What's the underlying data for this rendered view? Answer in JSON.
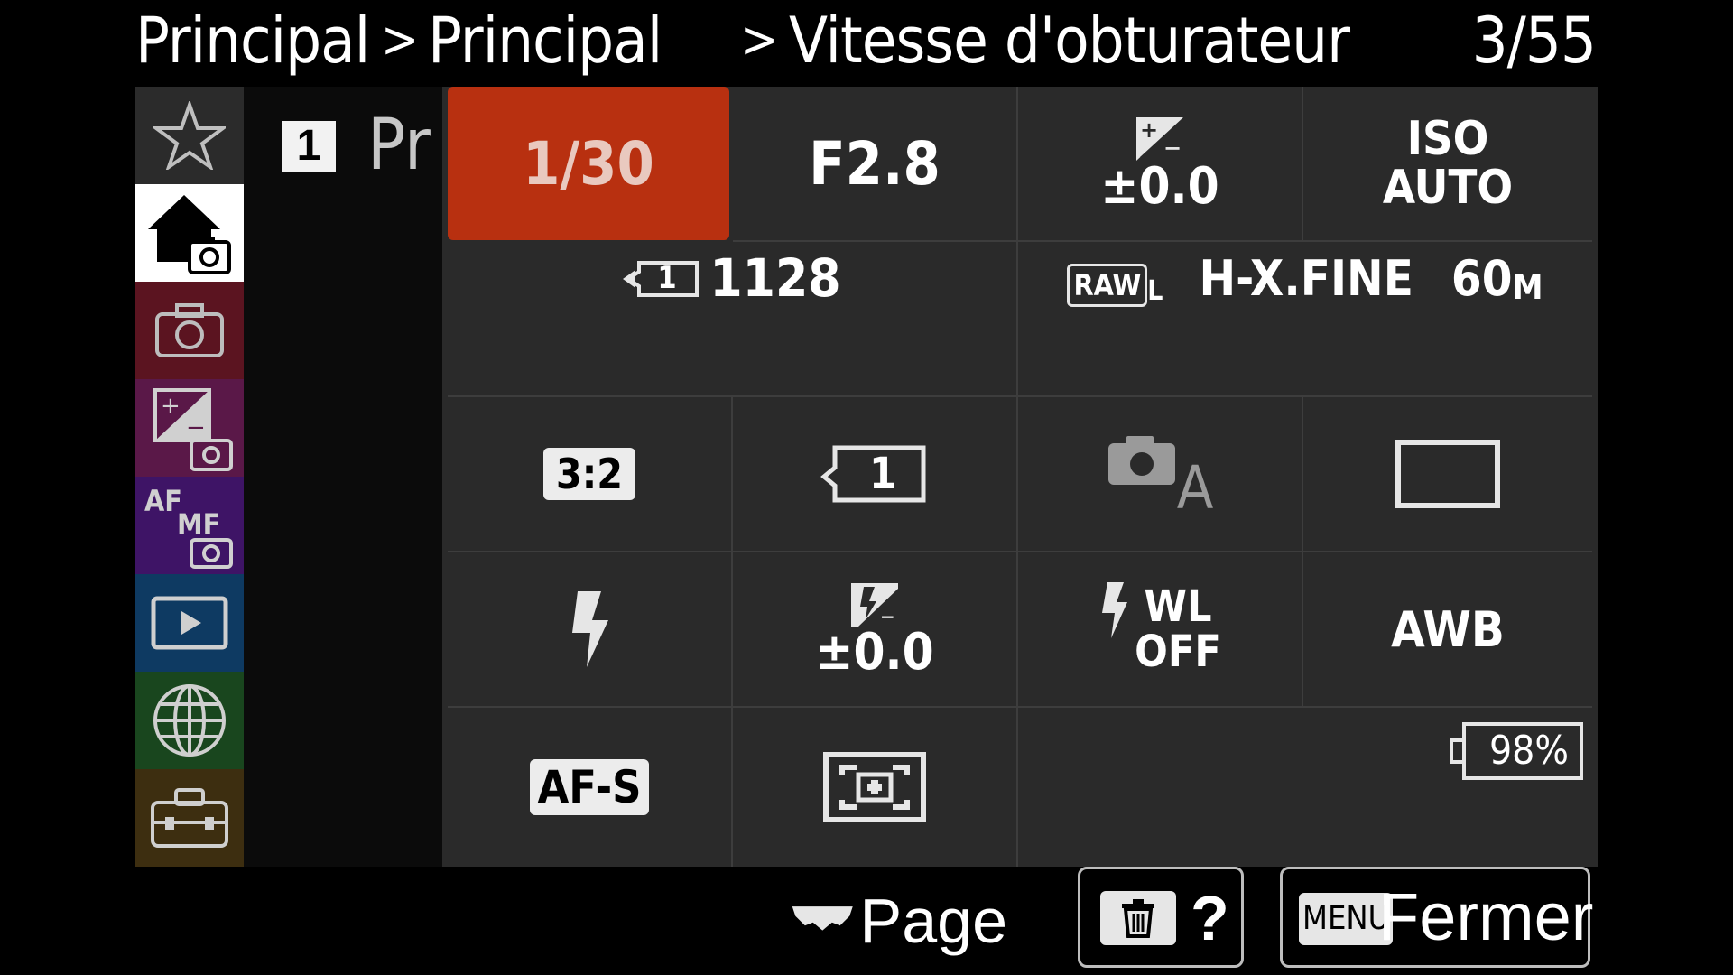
{
  "header": {
    "crumb1": "Principal",
    "sep1": ">",
    "crumb2": "Principal",
    "sep2": ">",
    "crumb3": "Vitesse d'obturateur",
    "page_counter": "3/55"
  },
  "sidebar": {
    "tabs": [
      {
        "id": "favorites",
        "icon": "star-icon",
        "color": "#2b2b2b"
      },
      {
        "id": "main",
        "icon": "home-camera-icon",
        "color": "#ffffff",
        "selected": true
      },
      {
        "id": "shooting",
        "icon": "camera-icon",
        "color": "#5b1420"
      },
      {
        "id": "exposure-color",
        "icon": "exposure-camera-icon",
        "color": "#5a1848"
      },
      {
        "id": "focus",
        "icon": "af-mf-camera-icon",
        "color": "#3e1466"
      },
      {
        "id": "playback",
        "icon": "play-icon",
        "color": "#0e3a62"
      },
      {
        "id": "network",
        "icon": "globe-icon",
        "color": "#19461e"
      },
      {
        "id": "setup",
        "icon": "toolbox-icon",
        "color": "#3d2e10"
      }
    ],
    "page_number": "1",
    "page_name": "Pr"
  },
  "grid": {
    "shutter": "1/30",
    "aperture": "F2.8",
    "exposure_comp": "±0.0",
    "iso_top": "ISO",
    "iso_bottom": "AUTO",
    "shots_remaining": "1128",
    "slot_number": "1",
    "raw_label": "RAW",
    "raw_size": "L",
    "jpeg_quality": "H-X.FINE",
    "image_size": "60",
    "image_size_unit": "M",
    "aspect": "3:2",
    "media_slot": "1",
    "drive_label": "A",
    "flash_comp": "±0.0",
    "wl_top": "WL",
    "wl_bottom": "OFF",
    "white_balance": "AWB",
    "focus_mode": "AF-S",
    "battery": "98%"
  },
  "footer": {
    "page_label": "Page",
    "help_label": "?",
    "menu_label": "MENU",
    "close_label": "Fermer"
  },
  "colors": {
    "accent": "#b83010",
    "panel": "#2a2a2a"
  }
}
